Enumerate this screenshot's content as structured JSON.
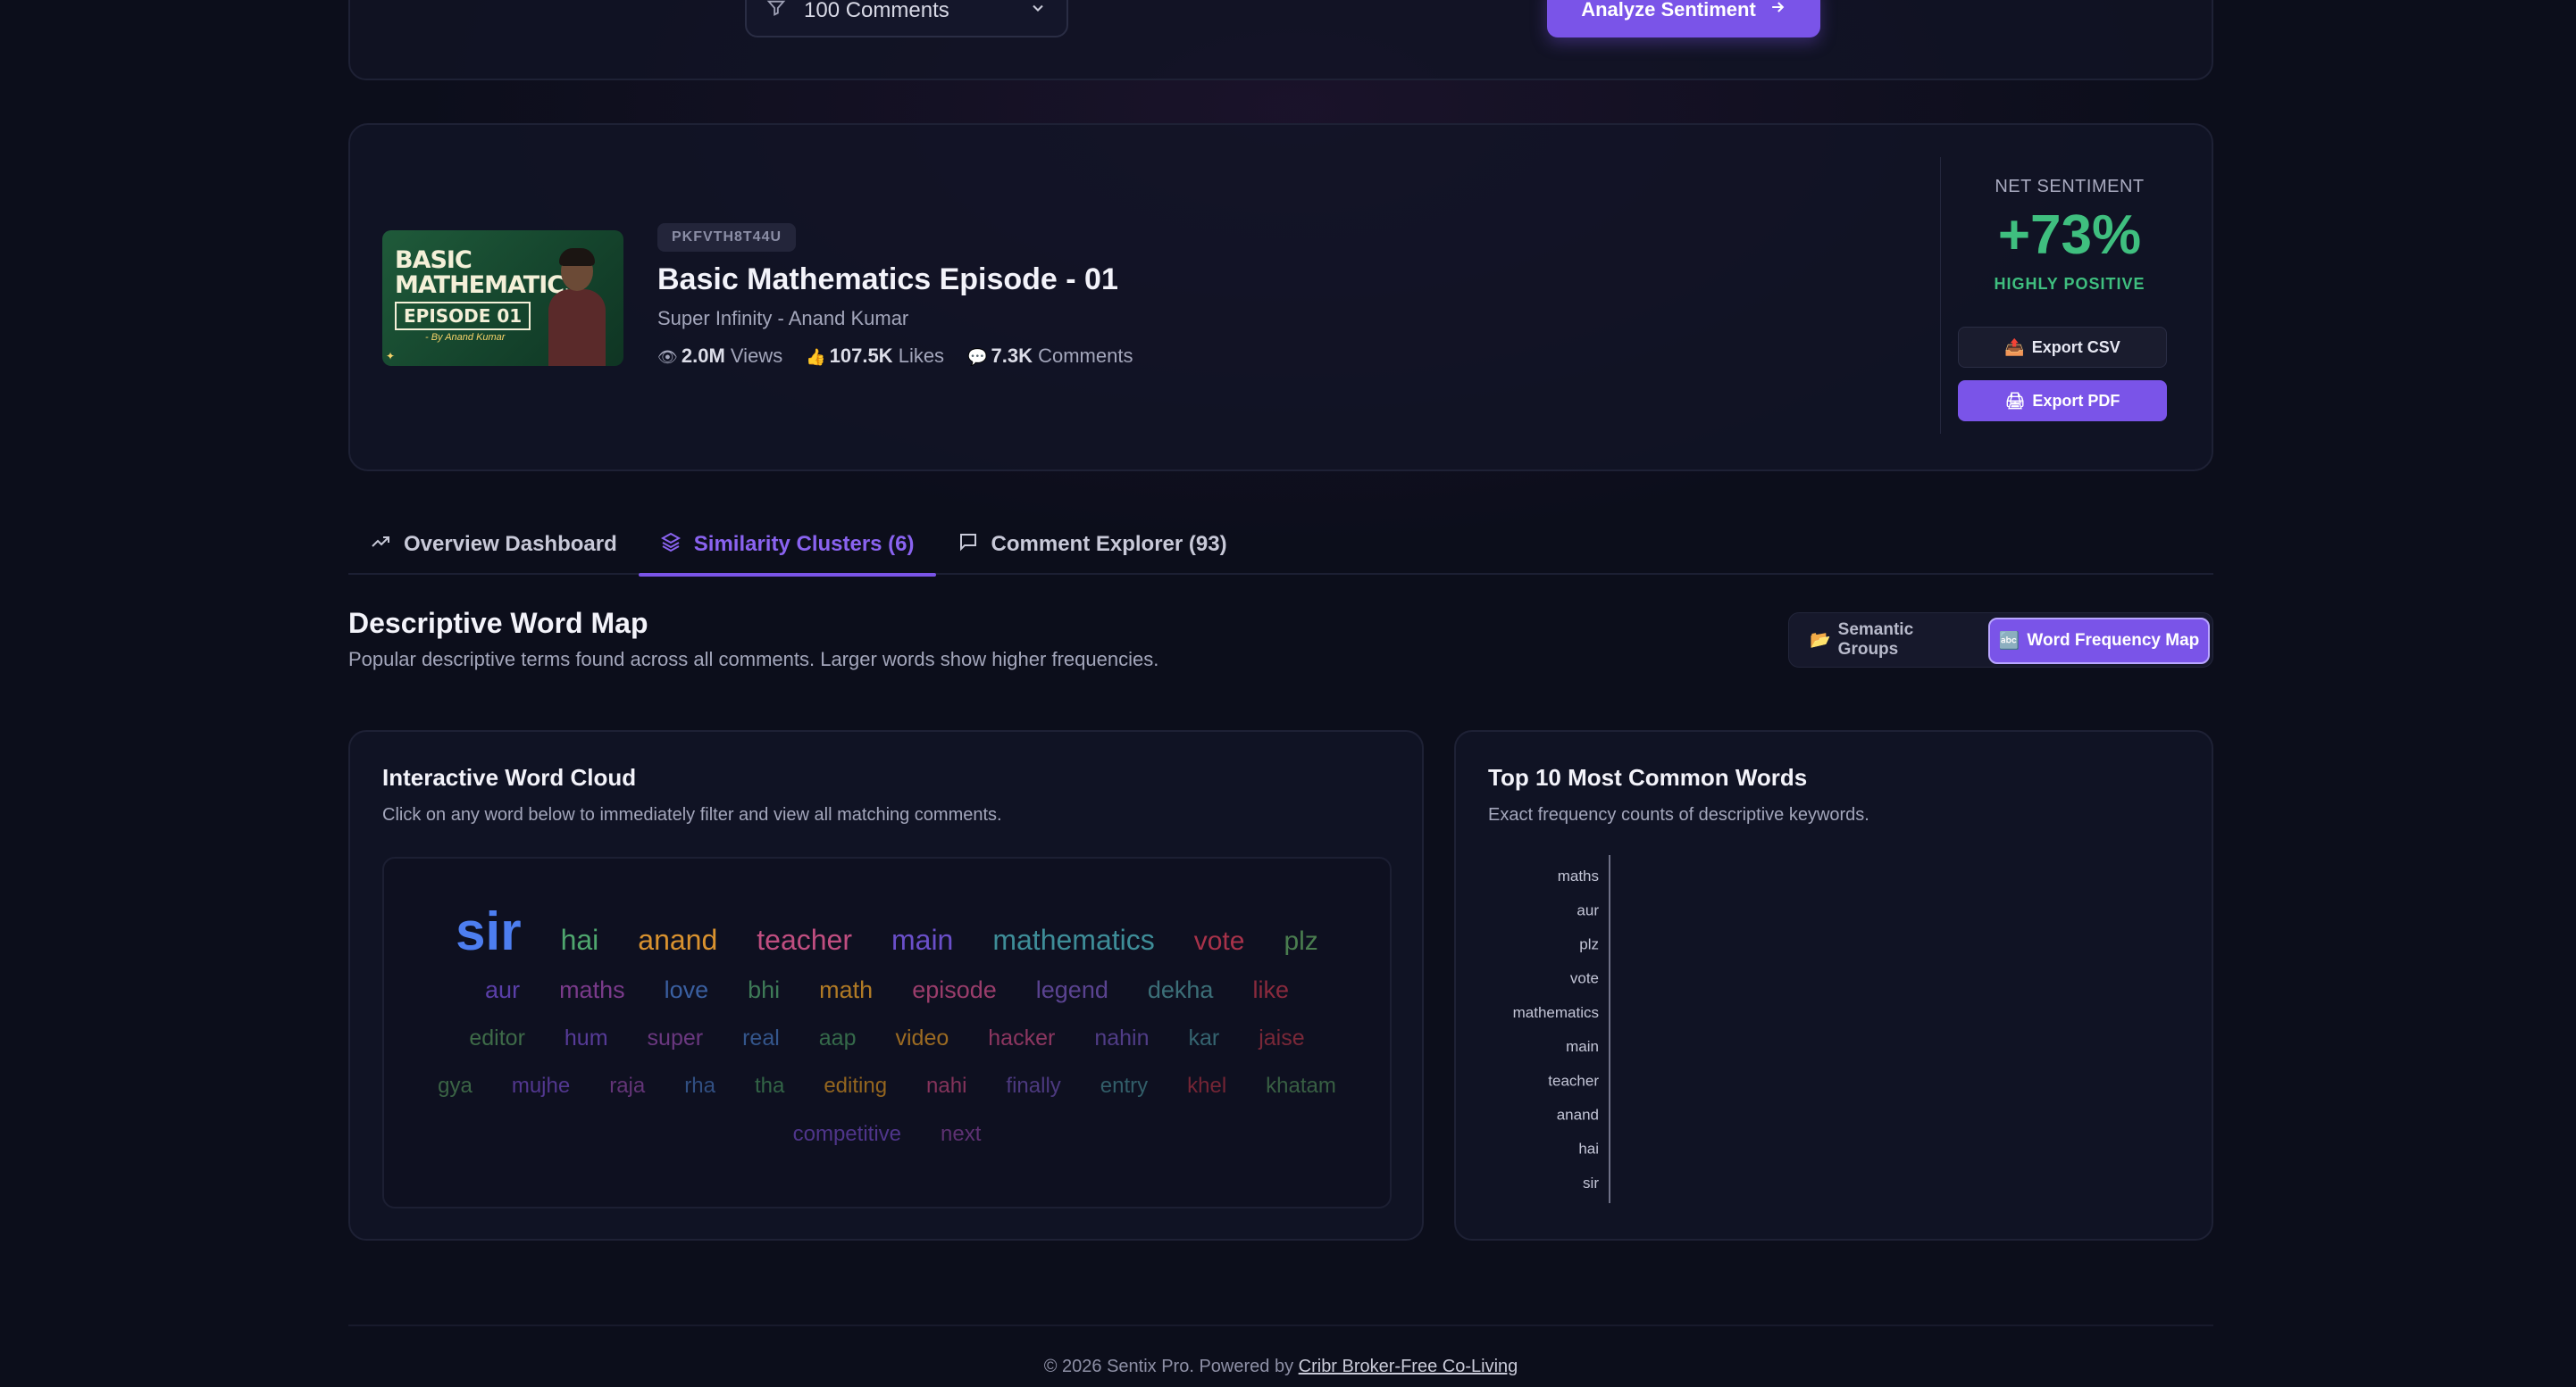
{
  "controls": {
    "comments_select": "100 Comments",
    "analyze_button": "Analyze Sentiment"
  },
  "video": {
    "id": "PKFVTH8T44U",
    "title": "Basic Mathematics Episode - 01",
    "channel": "Super Infinity - Anand Kumar",
    "views": "2.0M",
    "views_label": "Views",
    "likes": "107.5K",
    "likes_label": "Likes",
    "comments": "7.3K",
    "comments_label": "Comments",
    "thumbnail": {
      "line1": "BASIC",
      "line2": "MATHEMATICS",
      "episode": "EPISODE 01",
      "byline": "- By Anand Kumar"
    }
  },
  "sentiment": {
    "label": "NET SENTIMENT",
    "value": "+73%",
    "description": "HIGHLY POSITIVE",
    "export_csv": "Export CSV",
    "export_pdf": "Export PDF"
  },
  "tabs": [
    {
      "label": "Overview Dashboard",
      "icon": "trending-up-icon",
      "active": false
    },
    {
      "label": "Similarity Clusters (6)",
      "icon": "layers-icon",
      "active": true
    },
    {
      "label": "Comment Explorer (93)",
      "icon": "message-square-icon",
      "active": false
    }
  ],
  "section": {
    "title": "Descriptive Word Map",
    "subtitle": "Popular descriptive terms found across all comments. Larger words show higher frequencies.",
    "toggle_semantic": "Semantic Groups",
    "toggle_word": "Word Frequency Map"
  },
  "word_cloud": {
    "title": "Interactive Word Cloud",
    "subtitle": "Click on any word below to immediately filter and view all matching comments.",
    "rows": [
      [
        {
          "text": "sir",
          "size": 60,
          "color": "#4d7ef0",
          "bold": true
        },
        {
          "text": "hai",
          "size": 32,
          "color": "#4fa66e"
        },
        {
          "text": "anand",
          "size": 32,
          "color": "#d9922f"
        },
        {
          "text": "teacher",
          "size": 32,
          "color": "#c04e80"
        },
        {
          "text": "main",
          "size": 32,
          "color": "#6a4fc9"
        },
        {
          "text": "mathematics",
          "size": 32,
          "color": "#3e8d98"
        },
        {
          "text": "vote",
          "size": 30,
          "color": "#a8324a"
        },
        {
          "text": "plz",
          "size": 30,
          "color": "#4a7d4f"
        }
      ],
      [
        {
          "text": "aur",
          "size": 27,
          "color": "#5a3fa8"
        },
        {
          "text": "maths",
          "size": 27,
          "color": "#7a3a8a"
        },
        {
          "text": "love",
          "size": 27,
          "color": "#3a5fa0"
        },
        {
          "text": "bhi",
          "size": 27,
          "color": "#3e7a57"
        },
        {
          "text": "math",
          "size": 27,
          "color": "#b07a25"
        },
        {
          "text": "episode",
          "size": 27,
          "color": "#9a3d6b"
        },
        {
          "text": "legend",
          "size": 27,
          "color": "#5a4390"
        },
        {
          "text": "dekha",
          "size": 27,
          "color": "#3c6f78"
        },
        {
          "text": "like",
          "size": 27,
          "color": "#8a2a3d"
        }
      ],
      [
        {
          "text": "editor",
          "size": 25,
          "color": "#3e6b48"
        },
        {
          "text": "hum",
          "size": 25,
          "color": "#573b98"
        },
        {
          "text": "super",
          "size": 25,
          "color": "#6b3880"
        },
        {
          "text": "real",
          "size": 25,
          "color": "#34568c"
        },
        {
          "text": "aap",
          "size": 25,
          "color": "#356a4a"
        },
        {
          "text": "video",
          "size": 25,
          "color": "#9c6b22"
        },
        {
          "text": "hacker",
          "size": 25,
          "color": "#8c3660"
        },
        {
          "text": "nahin",
          "size": 25,
          "color": "#503c86"
        },
        {
          "text": "kar",
          "size": 25,
          "color": "#356470"
        },
        {
          "text": "jaise",
          "size": 25,
          "color": "#7a2838"
        }
      ],
      [
        {
          "text": "gya",
          "size": 24,
          "color": "#3b6445"
        },
        {
          "text": "mujhe",
          "size": 24,
          "color": "#52378f"
        },
        {
          "text": "raja",
          "size": 24,
          "color": "#633477"
        },
        {
          "text": "rha",
          "size": 24,
          "color": "#314f82"
        },
        {
          "text": "tha",
          "size": 24,
          "color": "#326446"
        },
        {
          "text": "editing",
          "size": 24,
          "color": "#93651f"
        },
        {
          "text": "nahi",
          "size": 24,
          "color": "#84335b"
        },
        {
          "text": "finally",
          "size": 24,
          "color": "#4c397f"
        },
        {
          "text": "entry",
          "size": 24,
          "color": "#325e69"
        },
        {
          "text": "khel",
          "size": 24,
          "color": "#742535"
        },
        {
          "text": "khatam",
          "size": 24,
          "color": "#385f43"
        }
      ],
      [
        {
          "text": "competitive",
          "size": 24,
          "color": "#4f358a"
        },
        {
          "text": "next",
          "size": 24,
          "color": "#5e3172"
        }
      ]
    ]
  },
  "top_words": {
    "title": "Top 10 Most Common Words",
    "subtitle": "Exact frequency counts of descriptive keywords."
  },
  "chart_data": {
    "type": "bar",
    "orientation": "horizontal",
    "categories": [
      "maths",
      "aur",
      "plz",
      "vote",
      "mathematics",
      "main",
      "teacher",
      "anand",
      "hai",
      "sir"
    ],
    "values": [
      0,
      0,
      0,
      0,
      0,
      0,
      0,
      0,
      0,
      0
    ],
    "title": "Top 10 Most Common Words",
    "xlabel": "",
    "ylabel": "",
    "grid": false
  },
  "footer": {
    "text": "© 2026 Sentix Pro. Powered by",
    "link": "Cribr Broker-Free Co-Living"
  }
}
